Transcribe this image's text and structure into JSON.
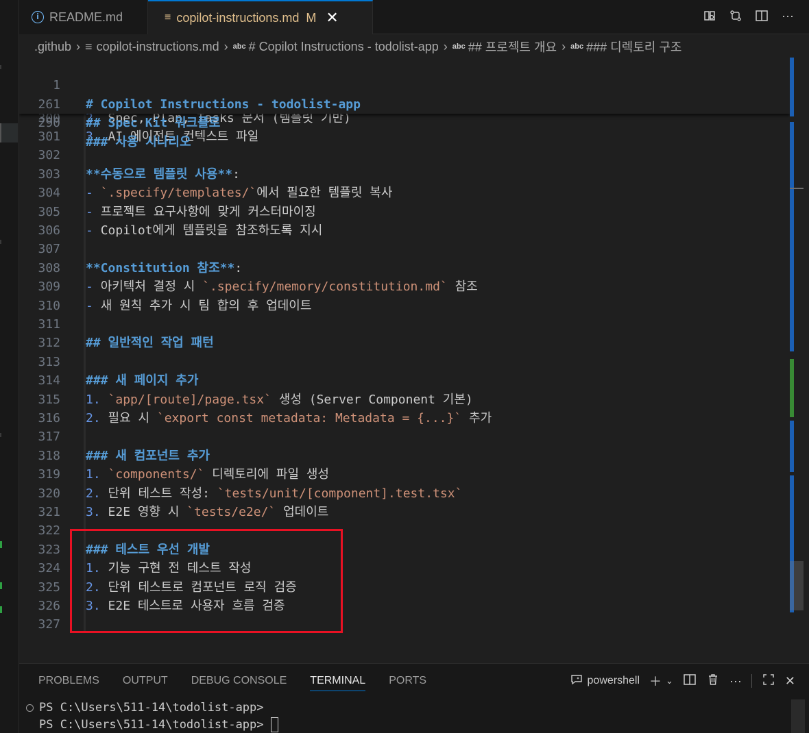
{
  "tabs": [
    {
      "label": "README.md",
      "icon": "info-icon",
      "active": false
    },
    {
      "label": "copilot-instructions.md",
      "icon": "lines-icon",
      "modified_badge": "M",
      "active": true
    }
  ],
  "breadcrumb": [
    {
      "label": ".github"
    },
    {
      "label": "copilot-instructions.md"
    },
    {
      "label": "# Copilot Instructions - todolist-app",
      "prefix": "abc"
    },
    {
      "label": "## 프로젝트 개요",
      "prefix": "abc"
    },
    {
      "label": "### 디렉토리 구조",
      "prefix": "abc"
    }
  ],
  "sticky_lines": [
    {
      "num": "1",
      "text": "# Copilot Instructions - todolist-app"
    },
    {
      "num": "261",
      "text": "## Spec Kit 워크플로"
    },
    {
      "num": "290",
      "text": "### 사용 시나리오"
    }
  ],
  "lines": [
    {
      "num": "300",
      "parts": [
        {
          "t": "2. ",
          "c": "lst"
        },
        {
          "t": "Spec, Plan, Tasks 문서 (템플릿 기반)",
          "c": "plain"
        }
      ]
    },
    {
      "num": "301",
      "parts": [
        {
          "t": "3. ",
          "c": "lst"
        },
        {
          "t": "AI 에이전트 컨텍스트 파일",
          "c": "plain"
        }
      ]
    },
    {
      "num": "302",
      "parts": []
    },
    {
      "num": "303",
      "parts": [
        {
          "t": "**수동으로 템플릿 사용**",
          "c": "b"
        },
        {
          "t": ":",
          "c": "plain"
        }
      ]
    },
    {
      "num": "304",
      "parts": [
        {
          "t": "- ",
          "c": "lst"
        },
        {
          "t": "`.specify/templates/`",
          "c": "inl"
        },
        {
          "t": "에서 필요한 템플릿 복사",
          "c": "plain"
        }
      ]
    },
    {
      "num": "305",
      "parts": [
        {
          "t": "- ",
          "c": "lst"
        },
        {
          "t": "프로젝트 요구사항에 맞게 커스터마이징",
          "c": "plain"
        }
      ]
    },
    {
      "num": "306",
      "parts": [
        {
          "t": "- ",
          "c": "lst"
        },
        {
          "t": "Copilot에게 템플릿을 참조하도록 지시",
          "c": "plain"
        }
      ]
    },
    {
      "num": "307",
      "parts": []
    },
    {
      "num": "308",
      "parts": [
        {
          "t": "**Constitution 참조**",
          "c": "b"
        },
        {
          "t": ":",
          "c": "plain"
        }
      ]
    },
    {
      "num": "309",
      "parts": [
        {
          "t": "- ",
          "c": "lst"
        },
        {
          "t": "아키텍처 결정 시 ",
          "c": "plain"
        },
        {
          "t": "`.specify/memory/constitution.md`",
          "c": "inl"
        },
        {
          "t": " 참조",
          "c": "plain"
        }
      ]
    },
    {
      "num": "310",
      "parts": [
        {
          "t": "- ",
          "c": "lst"
        },
        {
          "t": "새 원칙 추가 시 팀 합의 후 업데이트",
          "c": "plain"
        }
      ]
    },
    {
      "num": "311",
      "parts": []
    },
    {
      "num": "312",
      "parts": [
        {
          "t": "## 일반적인 작업 패턴",
          "c": "h"
        }
      ]
    },
    {
      "num": "313",
      "parts": []
    },
    {
      "num": "314",
      "parts": [
        {
          "t": "### 새 페이지 추가",
          "c": "h"
        }
      ]
    },
    {
      "num": "315",
      "parts": [
        {
          "t": "1. ",
          "c": "lst"
        },
        {
          "t": "`app/[route]/page.tsx`",
          "c": "inl"
        },
        {
          "t": " 생성 (Server Component 기본)",
          "c": "plain"
        }
      ]
    },
    {
      "num": "316",
      "parts": [
        {
          "t": "2. ",
          "c": "lst"
        },
        {
          "t": "필요 시 ",
          "c": "plain"
        },
        {
          "t": "`export const metadata: Metadata = {...}`",
          "c": "inl"
        },
        {
          "t": " 추가",
          "c": "plain"
        }
      ]
    },
    {
      "num": "317",
      "parts": []
    },
    {
      "num": "318",
      "parts": [
        {
          "t": "### 새 컴포넌트 추가",
          "c": "h"
        }
      ]
    },
    {
      "num": "319",
      "parts": [
        {
          "t": "1. ",
          "c": "lst"
        },
        {
          "t": "`components/`",
          "c": "inl"
        },
        {
          "t": " 디렉토리에 파일 생성",
          "c": "plain"
        }
      ]
    },
    {
      "num": "320",
      "parts": [
        {
          "t": "2. ",
          "c": "lst"
        },
        {
          "t": "단위 테스트 작성: ",
          "c": "plain"
        },
        {
          "t": "`tests/unit/[component].test.tsx`",
          "c": "inl"
        }
      ]
    },
    {
      "num": "321",
      "parts": [
        {
          "t": "3. ",
          "c": "lst"
        },
        {
          "t": "E2E 영향 시 ",
          "c": "plain"
        },
        {
          "t": "`tests/e2e/`",
          "c": "inl"
        },
        {
          "t": " 업데이트",
          "c": "plain"
        }
      ]
    },
    {
      "num": "322",
      "parts": []
    },
    {
      "num": "323",
      "parts": [
        {
          "t": "### 테스트 우선 개발",
          "c": "h"
        }
      ]
    },
    {
      "num": "324",
      "parts": [
        {
          "t": "1. ",
          "c": "lst"
        },
        {
          "t": "기능 구현 전 테스트 작성",
          "c": "plain"
        }
      ]
    },
    {
      "num": "325",
      "parts": [
        {
          "t": "2. ",
          "c": "lst"
        },
        {
          "t": "단위 테스트로 컴포넌트 로직 검증",
          "c": "plain"
        }
      ]
    },
    {
      "num": "326",
      "parts": [
        {
          "t": "3. ",
          "c": "lst"
        },
        {
          "t": "E2E 테스트로 사용자 흐름 검증",
          "c": "plain"
        }
      ]
    },
    {
      "num": "327",
      "parts": []
    }
  ],
  "panel": {
    "tabs": [
      "PROBLEMS",
      "OUTPUT",
      "DEBUG CONSOLE",
      "TERMINAL",
      "PORTS"
    ],
    "active_tab": "TERMINAL",
    "shell_label": "powershell",
    "terminal_lines": [
      "PS C:\\Users\\511-14\\todolist-app>",
      "PS C:\\Users\\511-14\\todolist-app>"
    ]
  },
  "colors": {
    "accent": "#0078d4",
    "heading": "#569cd6",
    "inline_code": "#ce9178",
    "modified": "#e2c08d",
    "highlight_box": "#e81123"
  }
}
